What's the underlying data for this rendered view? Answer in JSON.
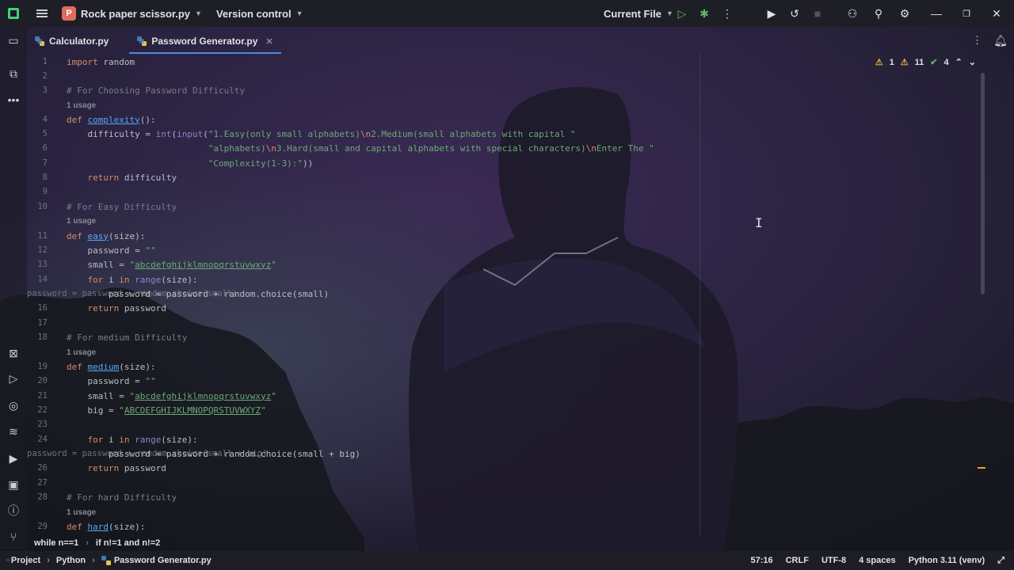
{
  "titlebar": {
    "project_initial": "P",
    "project_name": "Rock paper scissor.py",
    "vcs_label": "Version control",
    "run_config": "Current File"
  },
  "tabs": [
    {
      "label": "Calculator.py",
      "active": false
    },
    {
      "label": "Password Generator.py",
      "active": true
    }
  ],
  "inspections": {
    "warnings_a": "1",
    "warnings_b": "11",
    "ok": "4"
  },
  "code": {
    "l1": "1",
    "l2": "2",
    "l3": "3",
    "l4": "4",
    "l5": "5",
    "l6": "6",
    "l7": "7",
    "l8": "8",
    "l9": "9",
    "l10": "10",
    "l11": "11",
    "l12": "12",
    "l13": "13",
    "l14": "14",
    "l15": "password = password + random.choice(small)",
    "l16": "16",
    "l17": "17",
    "l18": "18",
    "l19": "19",
    "l20": "20",
    "l21": "21",
    "l22": "22",
    "l23": "23",
    "l24": "24",
    "l25": "password = password + random.choice(small + big)",
    "l26": "26",
    "l27": "27",
    "l28": "28",
    "l29": "29",
    "import_kw": "import",
    "import_mod": " random",
    "c1": "# For Choosing Password Difficulty",
    "usage": "1 usage",
    "def": "def",
    "fn_complexity": "complexity",
    "fn_complexity_tail": "():",
    "l5a": "difficulty = ",
    "int": "int",
    "l5b": "(",
    "input": "input",
    "l5c": "(",
    "s5a": "\"1.Easy(only small alphabets)",
    "esc_n": "\\n",
    "s5b": "2.Medium(small alphabets with capital \"",
    "s6a": "\"alphabets)",
    "s6b": "3.Hard(small and capital alphabets with special characters)",
    "s6c": "Enter The \"",
    "s7": "\"Complexity(1-3):\"",
    "l7tail": "))",
    "return": "return",
    "ret_difficulty": " difficulty",
    "c10": "# For Easy Difficulty",
    "fn_easy": "easy",
    "sig_size": "(size):",
    "l12a": "password = ",
    "empty_str": "\"\"",
    "l13a": "small = ",
    "lower_q": "\"",
    "lower": "abcdefghijklmnopqrstuvwxyz",
    "for": "for",
    "l14b": " i ",
    "in": "in",
    "range": "range",
    "l14c": "(size):",
    "ret_password": " password",
    "c18": "# For medium Difficulty",
    "fn_medium": "medium",
    "l22a": "big = ",
    "upper": "ABCDEFGHIJKLMNOPQRSTUVWXYZ",
    "c28": "# For hard Difficulty",
    "fn_hard": "hard"
  },
  "breadcrumbs": [
    "while n==1",
    "if n!=1 and n!=2"
  ],
  "status": {
    "project": "Project",
    "python": "Python",
    "file": "Password Generator.py",
    "position": "57:16",
    "line_sep": "CRLF",
    "encoding": "UTF-8",
    "indent": "4 spaces",
    "interpreter": "Python 3.11 (venv)"
  },
  "colors": {
    "accent": "#4b8ae0",
    "keyword": "#cf8e6d",
    "function": "#56a8f5",
    "string": "#6aab73",
    "comment": "#7a7e85",
    "warning": "#e8b43a",
    "ok": "#5fb865"
  }
}
